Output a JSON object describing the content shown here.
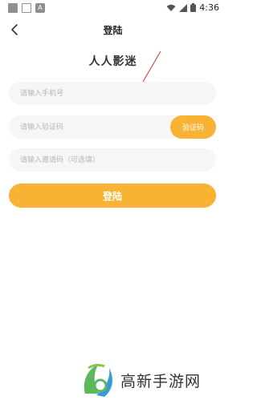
{
  "status_bar": {
    "time": "4:36",
    "icons": [
      "notification-icon",
      "image-icon",
      "a-icon",
      "wifi-icon",
      "signal-icon",
      "battery-icon"
    ]
  },
  "nav": {
    "title": "登陆",
    "back_icon": "back-arrow-icon"
  },
  "app_name": "人人影迷",
  "form": {
    "phone_placeholder": "请输入手机号",
    "code_placeholder": "请输入验证码",
    "code_button": "验证码",
    "invite_placeholder": "请输入邀请码（可选填）",
    "login_button": "登陆"
  },
  "watermark": {
    "text": "高新手游网"
  },
  "colors": {
    "accent": "#f9b233",
    "field_bg": "#f6f6f6",
    "annotation_arrow": "#c0392b"
  }
}
